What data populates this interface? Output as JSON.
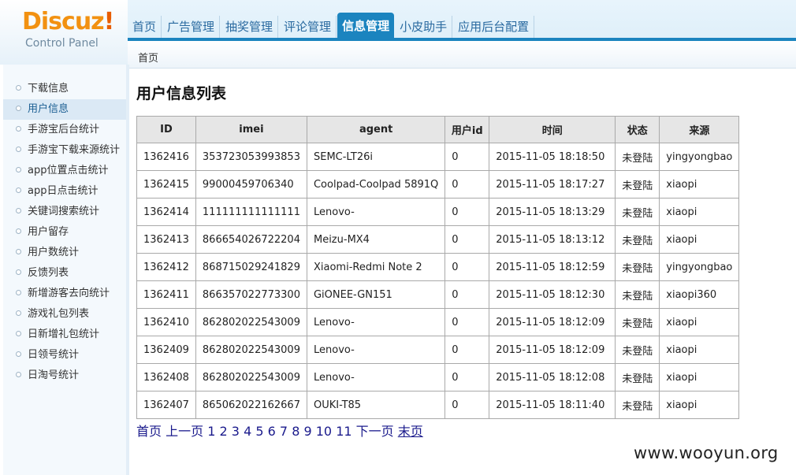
{
  "logo": {
    "main": "Discuz",
    "bang": "!",
    "sub": "Control Panel"
  },
  "topnav": [
    {
      "label": "首页"
    },
    {
      "label": "广告管理"
    },
    {
      "label": "抽奖管理"
    },
    {
      "label": "评论管理"
    },
    {
      "label": "信息管理",
      "active": true
    },
    {
      "label": "小皮助手"
    },
    {
      "label": "应用后台配置"
    }
  ],
  "breadcrumb": "首页",
  "sidebar": {
    "items": [
      {
        "label": "下载信息"
      },
      {
        "label": "用户信息",
        "active": true
      },
      {
        "label": "手游宝后台统计"
      },
      {
        "label": "手游宝下载来源统计"
      },
      {
        "label": "app位置点击统计"
      },
      {
        "label": "app日点击统计"
      },
      {
        "label": "关键词搜索统计"
      },
      {
        "label": "用户留存"
      },
      {
        "label": "用户数统计"
      },
      {
        "label": "反馈列表"
      },
      {
        "label": "新增游客去向统计"
      },
      {
        "label": "游戏礼包列表"
      },
      {
        "label": "日新增礼包统计"
      },
      {
        "label": "日领号统计"
      },
      {
        "label": "日淘号统计"
      }
    ]
  },
  "main": {
    "title": "用户信息列表",
    "table": {
      "headers": [
        "ID",
        "imei",
        "agent",
        "用户id",
        "时间",
        "状态",
        "来源"
      ],
      "rows": [
        [
          "1362416",
          "353723053993853",
          "SEMC-LT26i",
          "0",
          "2015-11-05 18:18:50",
          "未登陆",
          "yingyongbao"
        ],
        [
          "1362415",
          "99000459706340",
          "Coolpad-Coolpad 5891Q",
          "0",
          "2015-11-05 18:17:27",
          "未登陆",
          "xiaopi"
        ],
        [
          "1362414",
          "111111111111111",
          "Lenovo-",
          "0",
          "2015-11-05 18:13:29",
          "未登陆",
          "xiaopi"
        ],
        [
          "1362413",
          "866654026722204",
          "Meizu-MX4",
          "0",
          "2015-11-05 18:13:12",
          "未登陆",
          "xiaopi"
        ],
        [
          "1362412",
          "868715029241829",
          "Xiaomi-Redmi Note 2",
          "0",
          "2015-11-05 18:12:59",
          "未登陆",
          "yingyongbao"
        ],
        [
          "1362411",
          "866357022773300",
          "GiONEE-GN151",
          "0",
          "2015-11-05 18:12:30",
          "未登陆",
          "xiaopi360"
        ],
        [
          "1362410",
          "862802022543009",
          "Lenovo-",
          "0",
          "2015-11-05 18:12:09",
          "未登陆",
          "xiaopi"
        ],
        [
          "1362409",
          "862802022543009",
          "Lenovo-",
          "0",
          "2015-11-05 18:12:09",
          "未登陆",
          "xiaopi"
        ],
        [
          "1362408",
          "862802022543009",
          "Lenovo-",
          "0",
          "2015-11-05 18:12:08",
          "未登陆",
          "xiaopi"
        ],
        [
          "1362407",
          "865062022162667",
          "OUKI-T85",
          "0",
          "2015-11-05 18:11:40",
          "未登陆",
          "xiaopi"
        ]
      ]
    },
    "pager": {
      "first": "首页",
      "prev": "上一页",
      "pages": [
        "1",
        "2",
        "3",
        "4",
        "5",
        "6",
        "7",
        "8",
        "9",
        "10",
        "11"
      ],
      "next": "下一页",
      "last": "末页"
    }
  },
  "watermark": "www.wooyun.org",
  "colors": {
    "accent": "#1b84bf",
    "logo_orange": "#f29111",
    "link": "#1a1a8c"
  }
}
